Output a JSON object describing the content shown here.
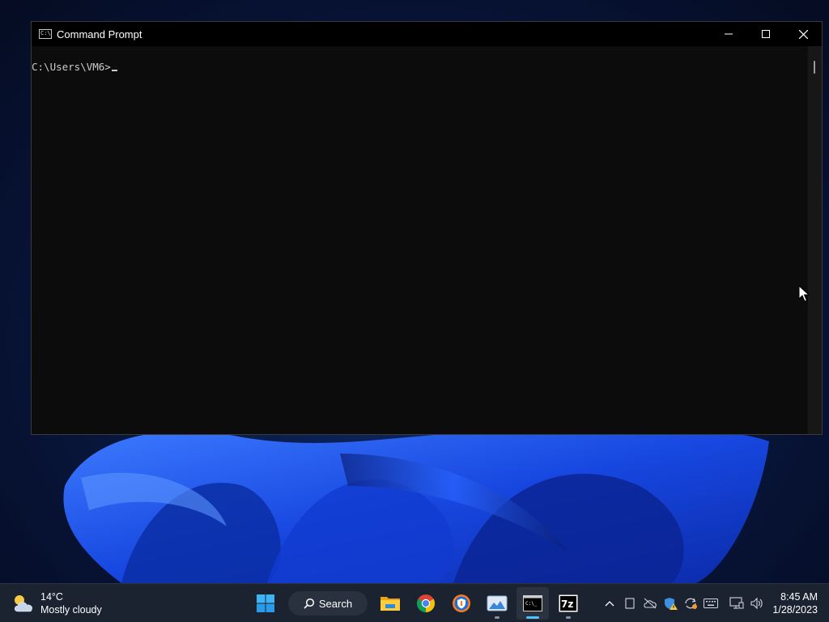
{
  "window": {
    "title": "Command Prompt",
    "prompt": "C:\\Users\\VM6>"
  },
  "taskbar": {
    "weather": {
      "temperature": "14°C",
      "condition": "Mostly cloudy",
      "icon": "partly-cloudy-icon"
    },
    "search_label": "Search",
    "apps": [
      {
        "name": "start-button",
        "icon": "windows-logo-icon"
      },
      {
        "name": "file-explorer",
        "icon": "folder-icon"
      },
      {
        "name": "chrome",
        "icon": "chrome-icon"
      },
      {
        "name": "security-app",
        "icon": "shield-app-icon"
      },
      {
        "name": "photos",
        "icon": "photos-icon"
      },
      {
        "name": "command-prompt",
        "icon": "terminal-icon",
        "active": true
      },
      {
        "name": "7zip",
        "icon": "7zip-icon"
      }
    ],
    "tray": [
      "chevron-up-icon",
      "tablet-icon",
      "cloud-off-icon",
      "defender-warning-icon",
      "sync-icon",
      "keyboard-icon",
      "network-icon",
      "volume-icon"
    ],
    "time": "8:45 AM",
    "date": "1/28/2023"
  },
  "colors": {
    "console_bg": "#0c0c0c",
    "console_text": "#cccccc",
    "titlebar_bg": "#000000",
    "taskbar_bg": "#1c2330",
    "accent": "#4cc2ff"
  }
}
